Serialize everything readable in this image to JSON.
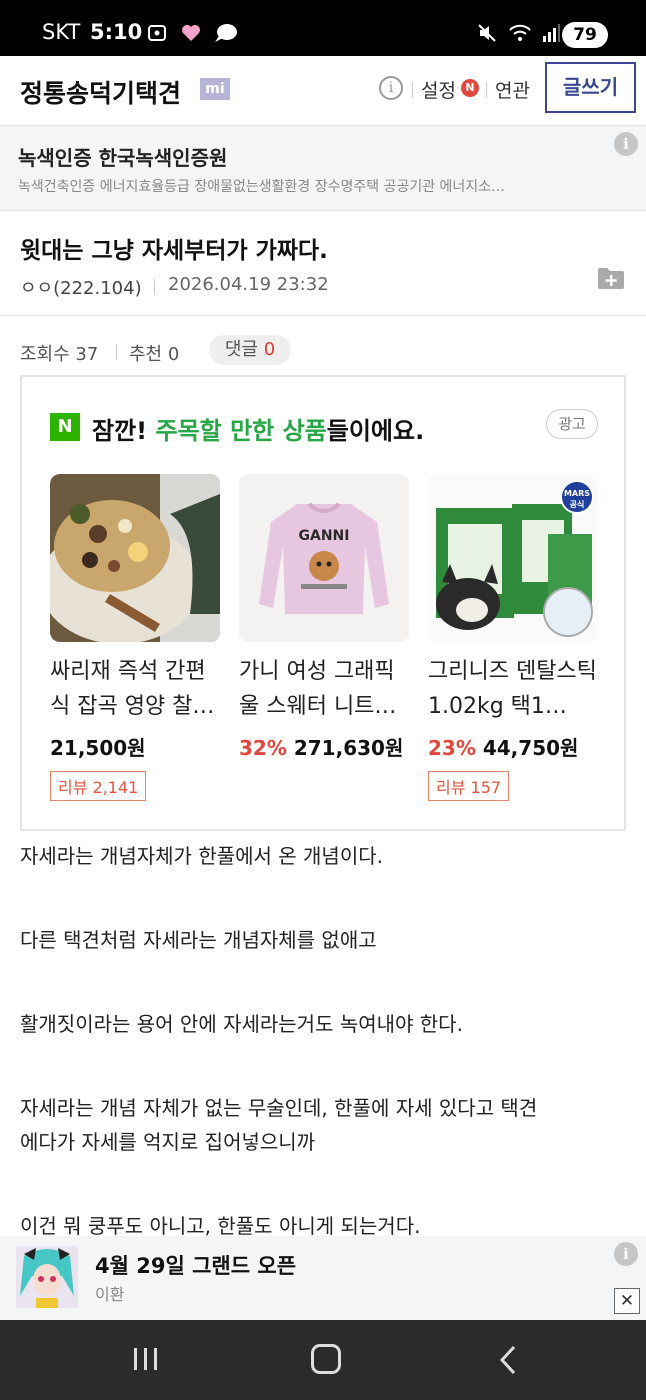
{
  "status_bar": {
    "carrier": "SKT",
    "time": "5:10",
    "battery": "79",
    "left_icons": [
      "screenshot-icon",
      "heart-icon",
      "chat-bubble-icon"
    ],
    "right_icons": [
      "mute-icon",
      "wifi-icon",
      "signal-icon"
    ]
  },
  "header": {
    "gallery_title": "정통송덕기택견",
    "mi_badge": "mi",
    "settings_label": "설정",
    "n_badge": "N",
    "related_label": "연관",
    "write_button": "글쓰기"
  },
  "top_ad": {
    "title": "녹색인증 한국녹색인증원",
    "description": "녹색건축인증 에너지효율등급 장애물없는생활환경 장수명주택 공공기관 에너지소…"
  },
  "post": {
    "title": "윗대는 그냥 자세부터가 가짜다.",
    "author": "ㅇㅇ(222.104)",
    "date": "2026.04.19 23:32",
    "views_label": "조회수 37",
    "recommend_label": "추천 0",
    "comment_label": "댓글",
    "comment_count": "0"
  },
  "product_ad": {
    "n_logo": "N",
    "headline_prefix": "잠깐! ",
    "headline_highlight": "주목할 만한 상품",
    "headline_suffix": "들이에요.",
    "ad_tag": "광고",
    "products": [
      {
        "name": "싸리재 즉석 간편식 잡곡 영양 찰…",
        "discount": "",
        "price": "21,500원",
        "review": "리뷰 2,141"
      },
      {
        "name": "가니 여성 그래픽 울 스웨터 니트…",
        "discount": "32%",
        "price": "271,630원",
        "review": ""
      },
      {
        "name": "그리니즈 덴탈스틱 1.02kg 택1…",
        "discount": "23%",
        "price": "44,750원",
        "review": "리뷰 157",
        "badge_line1": "MARS",
        "badge_line2": "공식"
      }
    ]
  },
  "content": {
    "paragraphs": [
      "자세라는 개념자체가 한풀에서 온 개념이다.",
      "다른 택견처럼 자세라는 개념자체를 없애고",
      "활개짓이라는 용어 안에 자세라는거도 녹여내야 한다.",
      "자세라는 개념 자체가 없는 무술인데, 한풀에 자세 있다고 택견",
      "에다가 자세를 억지로 집어넣으니까",
      "이건 뭐 쿵푸도 아니고, 한풀도 아니게 되는거다."
    ]
  },
  "bottom_ad": {
    "title": "4월 29일 그랜드 오픈",
    "subtitle": "이환"
  },
  "colors": {
    "accent_navy": "#3b4890",
    "naver_green": "#2db400",
    "highlight_green": "#26a645",
    "discount_red": "#e3473c"
  }
}
